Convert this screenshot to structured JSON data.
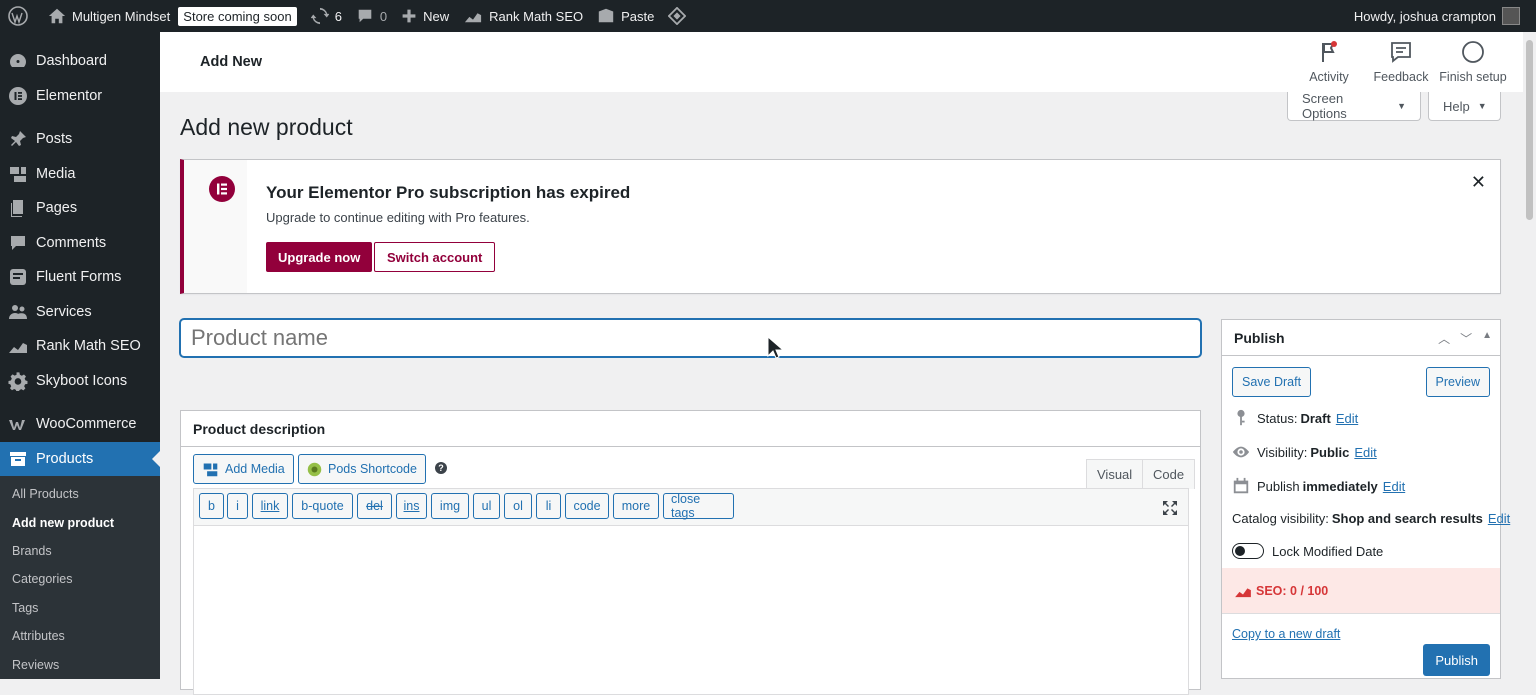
{
  "adminbar": {
    "site_name": "Multigen Mindset",
    "store_badge": "Store coming soon",
    "updates_count": "6",
    "comments_count": "0",
    "new_label": "New",
    "rankmath_label": "Rank Math SEO",
    "paste_label": "Paste",
    "howdy": "Howdy, joshua crampton"
  },
  "sidebar": {
    "items": [
      {
        "label": "Dashboard",
        "icon": "dashboard-icon"
      },
      {
        "label": "Elementor",
        "icon": "elementor-icon"
      },
      {
        "label": "Posts",
        "icon": "pin-icon"
      },
      {
        "label": "Media",
        "icon": "media-icon"
      },
      {
        "label": "Pages",
        "icon": "pages-icon"
      },
      {
        "label": "Comments",
        "icon": "comment-icon"
      },
      {
        "label": "Fluent Forms",
        "icon": "forms-icon"
      },
      {
        "label": "Services",
        "icon": "users-icon"
      },
      {
        "label": "Rank Math SEO",
        "icon": "chart-icon"
      },
      {
        "label": "Skyboot Icons",
        "icon": "gear-icon"
      },
      {
        "label": "WooCommerce",
        "icon": "woo-icon"
      },
      {
        "label": "Products",
        "icon": "archive-icon"
      }
    ],
    "submenu": [
      "All Products",
      "Add new product",
      "Brands",
      "Categories",
      "Tags",
      "Attributes",
      "Reviews"
    ]
  },
  "topbar": {
    "title": "Add New",
    "activity": "Activity",
    "feedback": "Feedback",
    "finish_setup": "Finish setup"
  },
  "screen_options": "Screen Options",
  "help": "Help",
  "page_title": "Add new product",
  "notice": {
    "title": "Your Elementor Pro subscription has expired",
    "text": "Upgrade to continue editing with Pro features.",
    "upgrade": "Upgrade now",
    "switch": "Switch account"
  },
  "product_name_placeholder": "Product name",
  "description": {
    "heading": "Product description",
    "add_media": "Add Media",
    "pods_shortcode": "Pods Shortcode",
    "tab_visual": "Visual",
    "tab_code": "Code",
    "quicktags": [
      "b",
      "i",
      "link",
      "b-quote",
      "del",
      "ins",
      "img",
      "ul",
      "ol",
      "li",
      "code",
      "more",
      "close tags"
    ]
  },
  "publish": {
    "heading": "Publish",
    "save_draft": "Save Draft",
    "preview": "Preview",
    "status_label": "Status:",
    "status_value": "Draft",
    "visibility_label": "Visibility:",
    "visibility_value": "Public",
    "publish_label": "Publish",
    "publish_value": "immediately",
    "catalog_label": "Catalog visibility:",
    "catalog_value": "Shop and search results",
    "edit": "Edit",
    "lock_modified": "Lock Modified Date",
    "seo": "SEO: 0 / 100",
    "copy_draft": "Copy to a new draft",
    "publish_button": "Publish"
  }
}
